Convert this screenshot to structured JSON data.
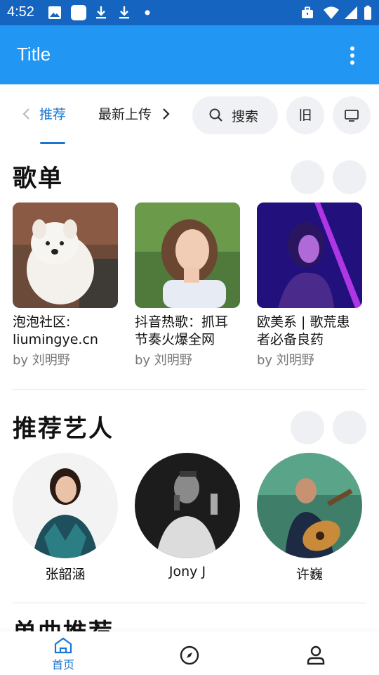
{
  "status_bar": {
    "time": "4:52",
    "left_icons": [
      "image-icon",
      "square-app-icon",
      "download-icon",
      "download-icon",
      "dot-icon"
    ],
    "right_icons": [
      "briefcase-icon",
      "wifi-icon",
      "signal-icon",
      "battery-icon"
    ]
  },
  "app_bar": {
    "title": "Title",
    "more_icon": "more-vert-icon",
    "color": "#2196f3"
  },
  "tabs": {
    "active_label": "推荐",
    "next_label": "最新上传",
    "search_label": "搜索",
    "old_label": "旧",
    "accent": "#1976d2"
  },
  "playlists": {
    "title": "歌单",
    "items": [
      {
        "name": "泡泡社区: liumingye.cn",
        "by": "by 刘明野"
      },
      {
        "name": "抖音热歌：抓耳节奏火爆全网",
        "by": "by 刘明野"
      },
      {
        "name": "欧美系 | 歌荒患者必备良药",
        "by": "by 刘明野"
      }
    ]
  },
  "artists": {
    "title": "推荐艺人",
    "items": [
      {
        "name": "张韶涵"
      },
      {
        "name": "Jony J"
      },
      {
        "name": "许巍"
      }
    ]
  },
  "next_section": {
    "title": "单曲推荐"
  },
  "bottom_nav": {
    "home_label": "首页",
    "items": [
      "home-icon",
      "explore-icon",
      "user-icon"
    ]
  }
}
